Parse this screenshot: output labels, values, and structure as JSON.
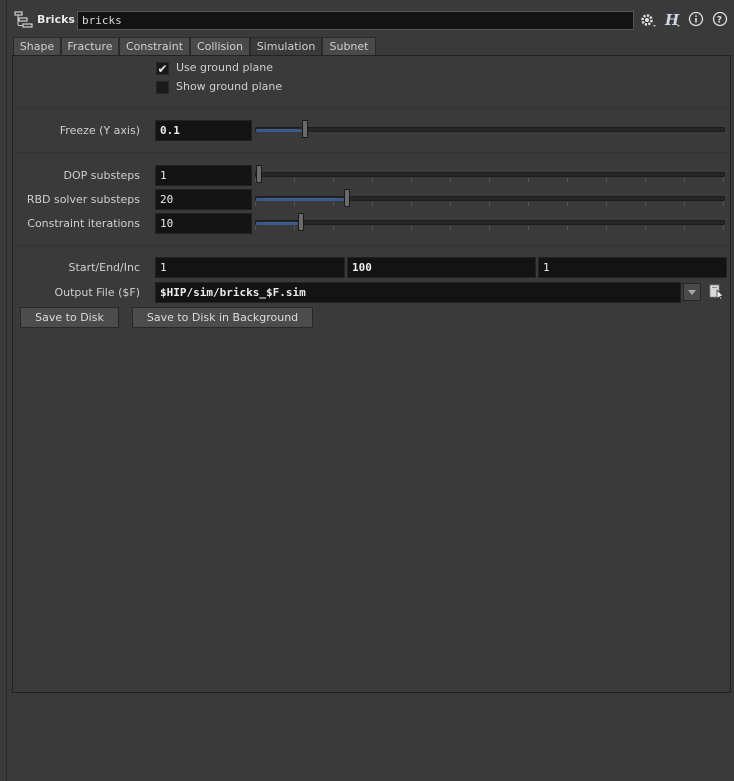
{
  "header": {
    "node_type": "Bricks",
    "node_name": "bricks",
    "icons": [
      "node-type-icon",
      "gear-icon",
      "houdini-help-icon",
      "info-icon",
      "question-icon"
    ]
  },
  "tabs": [
    {
      "label": "Shape"
    },
    {
      "label": "Fracture"
    },
    {
      "label": "Constraint"
    },
    {
      "label": "Collision"
    },
    {
      "label": "Simulation",
      "active": true
    },
    {
      "label": "Subnet"
    }
  ],
  "ground": {
    "use_label": "Use ground plane",
    "use_checked": true,
    "show_label": "Show ground plane",
    "show_checked": false
  },
  "freeze": {
    "label": "Freeze (Y axis)",
    "value": "0.1",
    "slider_fraction": 0.1
  },
  "dop_substeps": {
    "label": "DOP substeps",
    "value": "1",
    "slider_fraction": 0.0
  },
  "rbd_substeps": {
    "label": "RBD solver substeps",
    "value": "20",
    "slider_fraction": 0.19
  },
  "constraint_iterations": {
    "label": "Constraint iterations",
    "value": "10",
    "slider_fraction": 0.09
  },
  "frame_range": {
    "label": "Start/End/Inc",
    "start": "1",
    "end": "100",
    "inc": "1"
  },
  "output_file": {
    "label": "Output File ($F)",
    "value": "$HIP/sim/bricks_$F.sim"
  },
  "buttons": {
    "save_to_disk": "Save to Disk",
    "save_background": "Save to Disk in Background"
  },
  "accent_color": "#3c5a8a"
}
